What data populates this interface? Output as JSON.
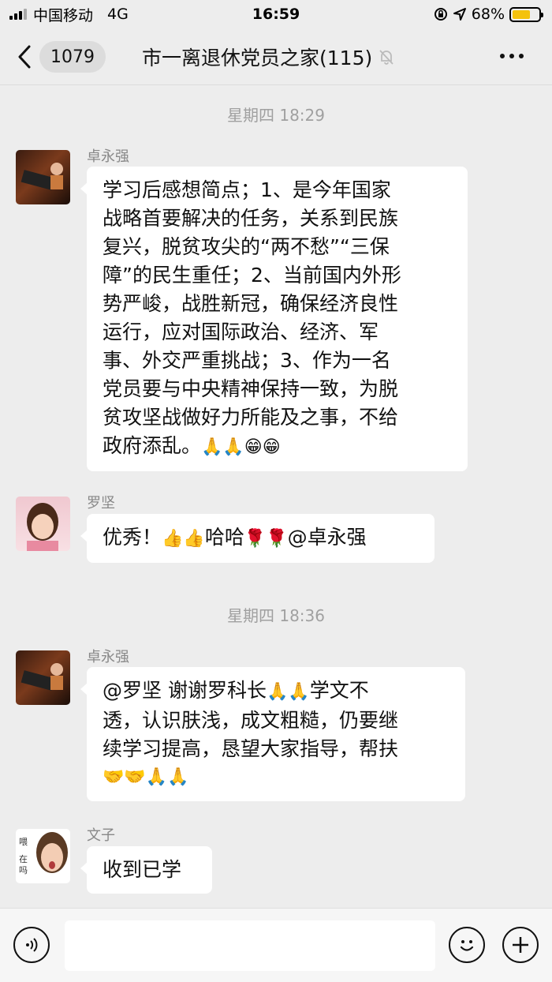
{
  "status_bar": {
    "carrier": "中国移动",
    "network": "4G",
    "time": "16:59",
    "battery_percent": "68%",
    "battery_level": 0.68
  },
  "nav": {
    "back_count": "1079",
    "title": "市一离退休党员之家(115)"
  },
  "messages": [
    {
      "time_separator": "星期四 18:29",
      "sender": "卓永强",
      "lines": [
        "学习后感想简点；1、是今年国家",
        "战略首要解决的任务，关系到民族",
        "复兴，脱贫攻尖的“两不愁”“三保",
        "障”的民生重任；2、当前国内外形",
        "势严峻，战胜新冠，确保经济良性",
        "运行，应对国际政治、经济、军",
        "事、外交严重挑战；3、作为一名",
        "党员要与中央精神保持一致，为脱",
        "贫攻坚战做好力所能及之事，不给",
        "政府添乱。"
      ],
      "emojis": "🙏🙏😁😁"
    },
    {
      "sender": "罗坚",
      "text_prefix": "优秀！",
      "emojis_mid": "👍👍",
      "text_mid": "哈哈",
      "emojis_end": "🌹🌹",
      "text_end": "@卓永强"
    },
    {
      "time_separator": "星期四 18:36",
      "sender": "卓永强",
      "line1_prefix": "@罗坚 谢谢罗科长",
      "line1_emojis": "🙏🙏",
      "line1_suffix": "学文不",
      "line2": "透，认识肤浅，成文粗糙，仍要继",
      "line3": "续学习提高，恳望大家指导，帮扶",
      "line4_emojis": "🤝🤝🙏🙏"
    },
    {
      "sender": "文子",
      "text": "收到已学",
      "avatar_text_1": "喂",
      "avatar_text_2": "在",
      "avatar_text_3": "吗"
    }
  ],
  "colors": {
    "background": "#ededed",
    "bubble": "#ffffff",
    "battery": "#f4c20d"
  }
}
